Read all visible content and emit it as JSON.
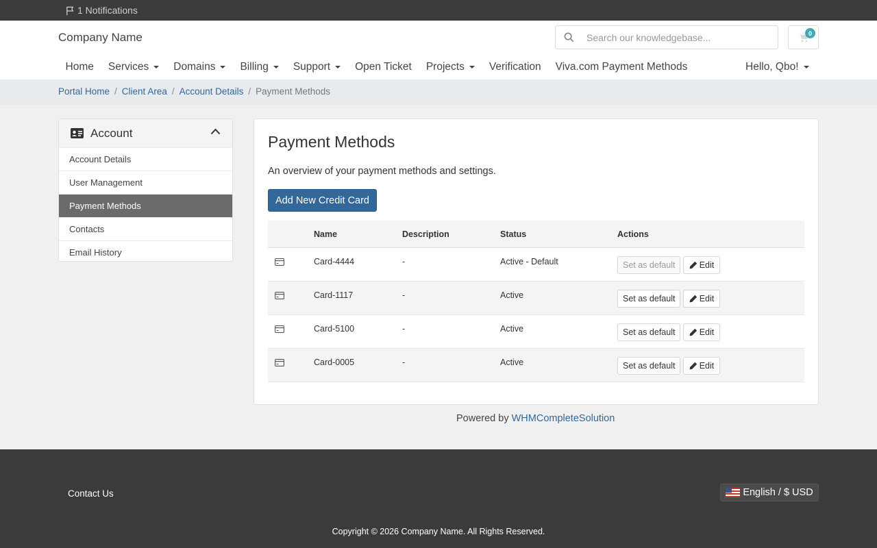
{
  "topbar": {
    "notifications_label": "1 Notifications"
  },
  "header": {
    "brand": "Company Name",
    "search_placeholder": "Search our knowledgebase...",
    "cart_count": "0"
  },
  "nav": {
    "home": "Home",
    "services": "Services",
    "domains": "Domains",
    "billing": "Billing",
    "support": "Support",
    "open_ticket": "Open Ticket",
    "projects": "Projects",
    "verification": "Verification",
    "viva": "Viva.com Payment Methods",
    "hello": "Hello, Qbo!"
  },
  "breadcrumb": {
    "portal_home": "Portal Home",
    "client_area": "Client Area",
    "account_details": "Account Details",
    "current": "Payment Methods",
    "separator": "/"
  },
  "sidebar": {
    "title": "Account",
    "items": [
      {
        "label": "Account Details"
      },
      {
        "label": "User Management"
      },
      {
        "label": "Payment Methods"
      },
      {
        "label": "Contacts"
      },
      {
        "label": "Email History"
      }
    ]
  },
  "main": {
    "title": "Payment Methods",
    "lead": "An overview of your payment methods and settings.",
    "add_button": "Add New Credit Card",
    "columns": {
      "name": "Name",
      "description": "Description",
      "status": "Status",
      "actions": "Actions"
    },
    "rows": [
      {
        "name": "Card-4444",
        "description": "-",
        "status": "Active - Default",
        "set_default": "Set as default",
        "edit": "Edit"
      },
      {
        "name": "Card-1117",
        "description": "-",
        "status": "Active",
        "set_default": "Set as default",
        "edit": "Edit"
      },
      {
        "name": "Card-5100",
        "description": "-",
        "status": "Active",
        "set_default": "Set as default",
        "edit": "Edit"
      },
      {
        "name": "Card-0005",
        "description": "-",
        "status": "Active",
        "set_default": "Set as default",
        "edit": "Edit"
      }
    ]
  },
  "powered": {
    "prefix": "Powered by",
    "link": "WHMCompleteSolution"
  },
  "footer": {
    "contact": "Contact Us",
    "language": "English / $ USD",
    "copyright": "Copyright © 2026 Company Name. All Rights Reserved."
  },
  "colors": {
    "accent": "#336699",
    "cart_badge": "#3fa9b7",
    "dark_bar": "#3b3b3b"
  }
}
